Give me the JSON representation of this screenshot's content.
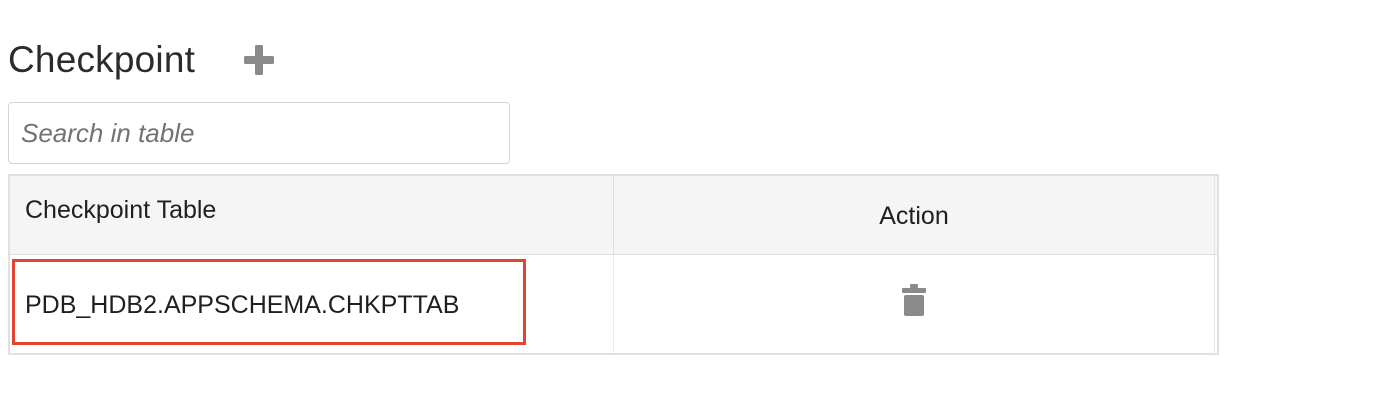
{
  "page": {
    "title": "Checkpoint",
    "add_icon": "plus-icon"
  },
  "search": {
    "placeholder": "Search in table",
    "value": ""
  },
  "table": {
    "columns": [
      "Checkpoint Table",
      "Action"
    ],
    "rows": [
      {
        "checkpoint_table": "PDB_HDB2.APPSCHEMA.CHKPTTAB",
        "action_icon": "trash-icon",
        "highlighted": true
      }
    ]
  },
  "colors": {
    "highlight": "#e2442f",
    "icon_gray": "#8a8a8a",
    "header_bg": "#f5f5f5"
  }
}
